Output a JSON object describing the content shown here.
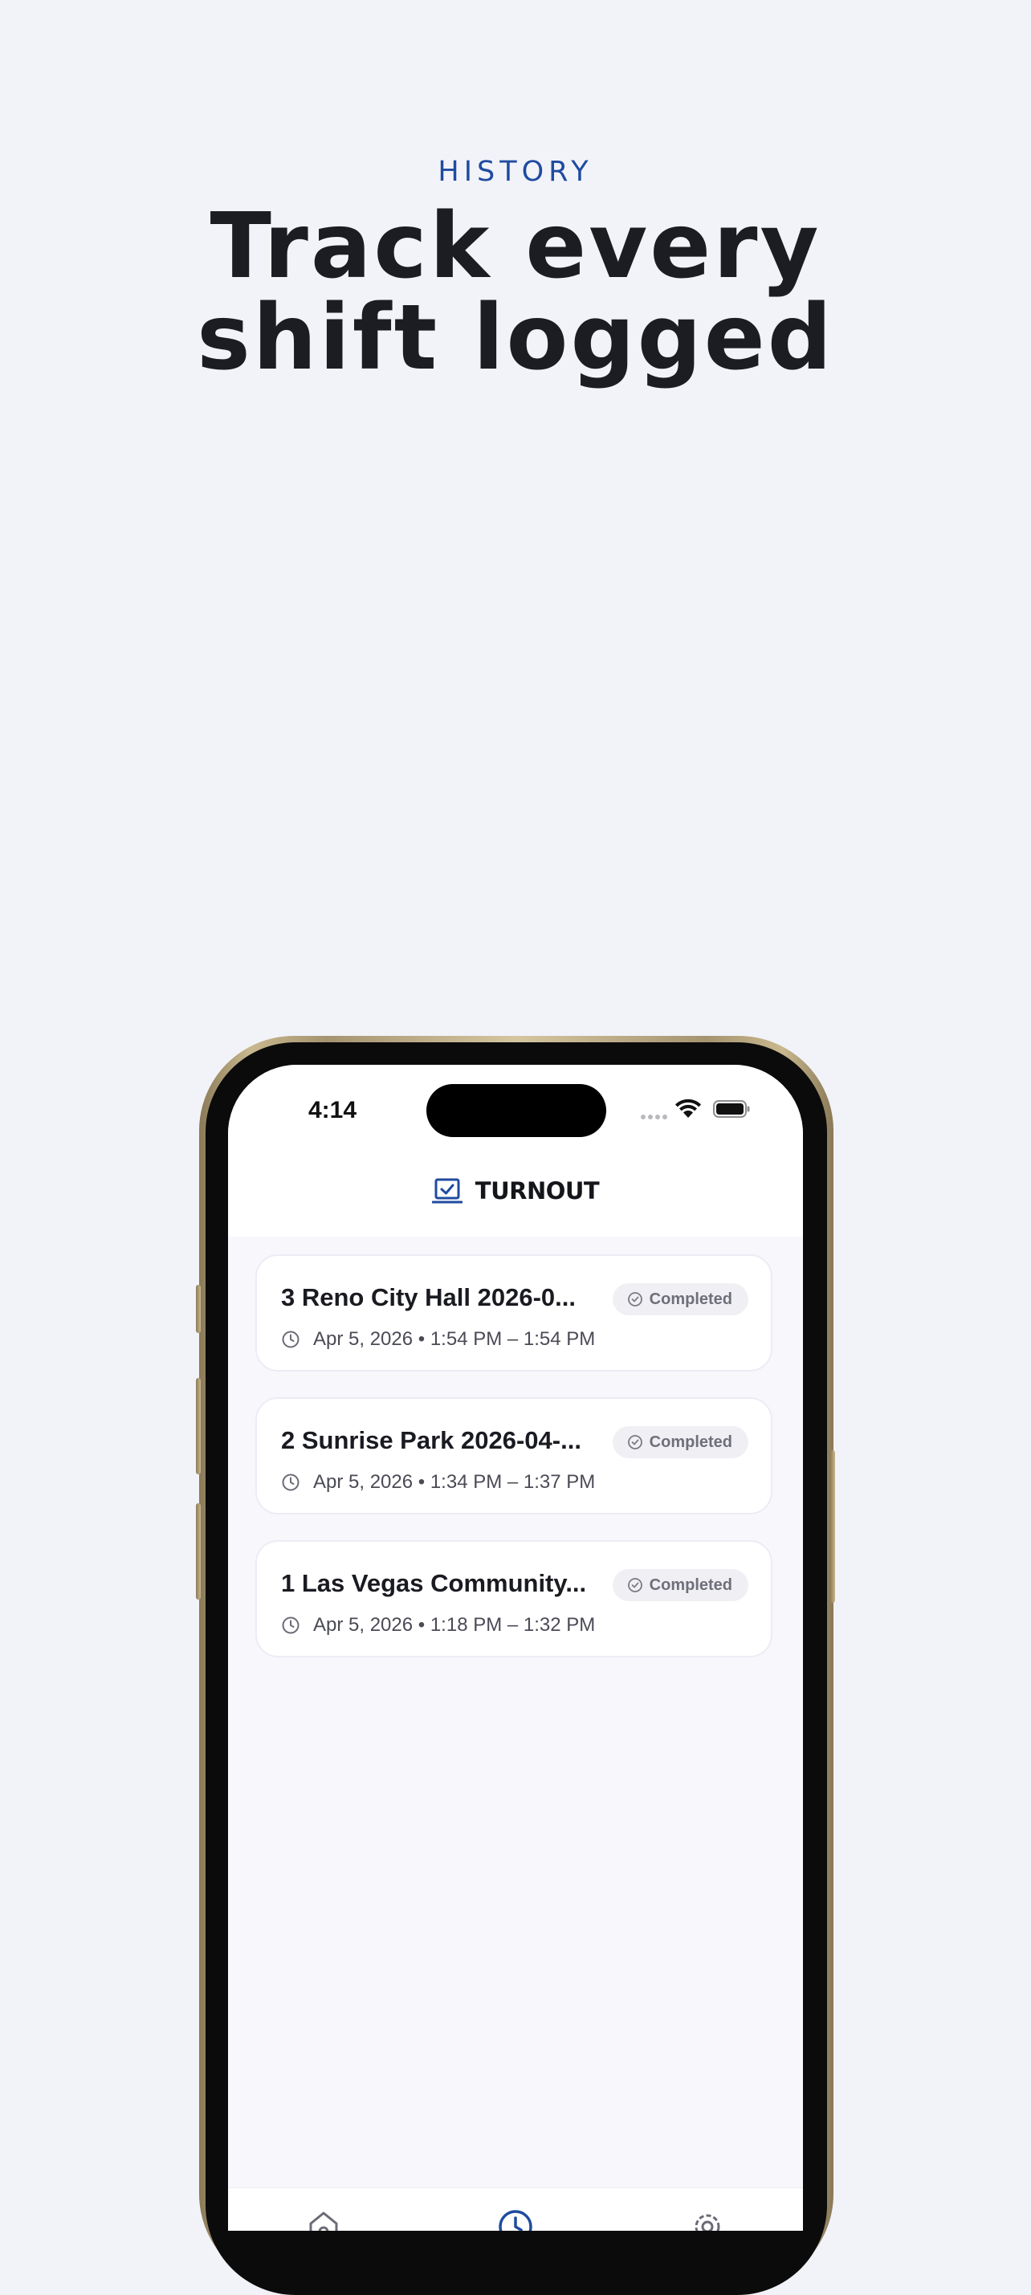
{
  "marketing": {
    "eyebrow": "HISTORY",
    "headline_line1": "Track every",
    "headline_line2": "shift logged"
  },
  "status_bar": {
    "time": "4:14"
  },
  "app": {
    "title": "TURNOUT",
    "logo_icon": "checklist-icon",
    "accent_color": "#1f4ba0"
  },
  "history": {
    "items": [
      {
        "title": "3 Reno City Hall 2026-0...",
        "status": "Completed",
        "time_range": "Apr 5, 2026 • 1:54 PM – 1:54 PM"
      },
      {
        "title": "2 Sunrise Park 2026-04-...",
        "status": "Completed",
        "time_range": "Apr 5, 2026 • 1:34 PM – 1:37 PM"
      },
      {
        "title": "1 Las Vegas Community...",
        "status": "Completed",
        "time_range": "Apr 5, 2026 • 1:18 PM – 1:32 PM"
      }
    ]
  },
  "tabs": [
    {
      "icon": "home-icon",
      "active": false
    },
    {
      "icon": "clock-icon",
      "active": true
    },
    {
      "icon": "gear-icon",
      "active": false
    }
  ]
}
